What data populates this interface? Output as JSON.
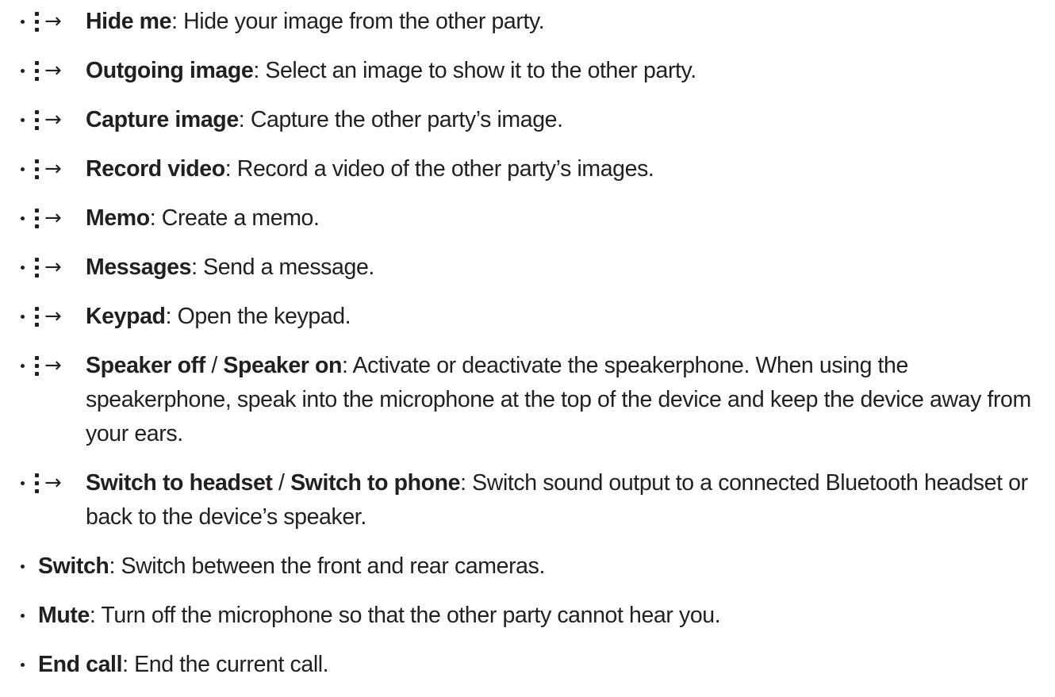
{
  "arrow": "→",
  "items": [
    {
      "has_icon": true,
      "bold1": "Hide me",
      "desc": ": Hide your image from the other party."
    },
    {
      "has_icon": true,
      "bold1": "Outgoing image",
      "desc": ": Select an image to show it to the other party."
    },
    {
      "has_icon": true,
      "bold1": "Capture image",
      "desc": ": Capture the other party’s image."
    },
    {
      "has_icon": true,
      "bold1": "Record video",
      "desc": ": Record a video of the other party’s images."
    },
    {
      "has_icon": true,
      "bold1": "Memo",
      "desc": ": Create a memo."
    },
    {
      "has_icon": true,
      "bold1": "Messages",
      "desc": ": Send a message."
    },
    {
      "has_icon": true,
      "bold1": "Keypad",
      "desc": ": Open the keypad."
    },
    {
      "has_icon": true,
      "bold1": "Speaker off",
      "sep": " / ",
      "bold2": "Speaker on",
      "desc": ": Activate or deactivate the speakerphone. When using the speakerphone, speak into the microphone at the top of the device and keep the device away from your ears."
    },
    {
      "has_icon": true,
      "bold1": "Switch to headset",
      "sep": " / ",
      "bold2": "Switch to phone",
      "desc": ": Switch sound output to a connected Bluetooth headset or back to the device’s speaker."
    },
    {
      "has_icon": false,
      "bold1": "Switch",
      "desc": ": Switch between the front and rear cameras."
    },
    {
      "has_icon": false,
      "bold1": "Mute",
      "desc": ": Turn off the microphone so that the other party cannot hear you."
    },
    {
      "has_icon": false,
      "bold1": "End call",
      "desc": ": End the current call."
    }
  ]
}
